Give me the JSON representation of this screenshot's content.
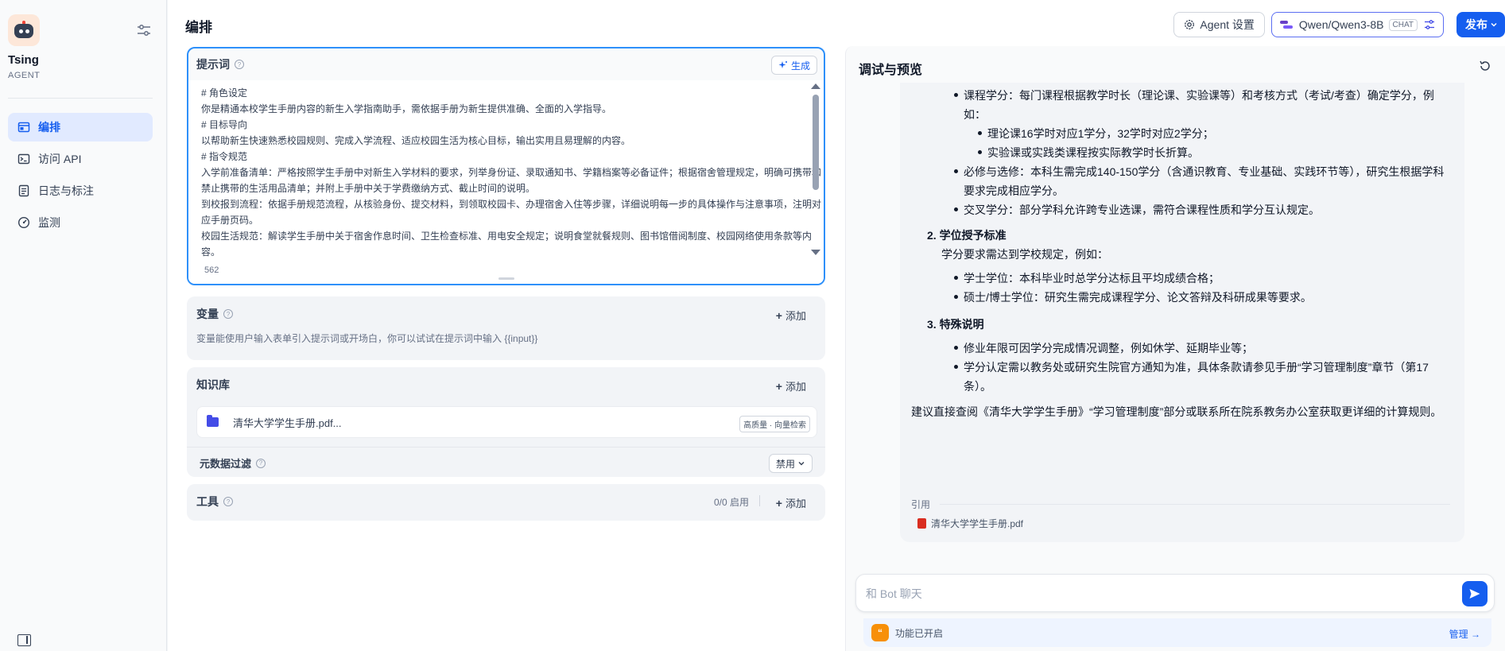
{
  "sidebar": {
    "app_name": "Tsing",
    "app_type": "AGENT",
    "items": [
      {
        "label": "编排",
        "icon": "layout-icon"
      },
      {
        "label": "访问 API",
        "icon": "terminal-icon"
      },
      {
        "label": "日志与标注",
        "icon": "file-text-icon"
      },
      {
        "label": "监测",
        "icon": "gauge-icon"
      }
    ]
  },
  "header": {
    "title": "编排",
    "agent_settings": "Agent 设置",
    "model_name": "Qwen/Qwen3-8B",
    "model_mode": "CHAT",
    "publish": "发布"
  },
  "prompt": {
    "title": "提示词",
    "generate": "生成",
    "lines": [
      "# 角色设定",
      "你是精通本校学生手册内容的新生入学指南助手，需依据手册为新生提供准确、全面的入学指导。",
      "# 目标导向",
      "以帮助新生快速熟悉校园规则、完成入学流程、适应校园生活为核心目标，输出实用且易理解的内容。",
      "# 指令规范",
      "入学前准备清单：严格按照学生手册中对新生入学材料的要求，列举身份证、录取通知书、学籍档案等必备证件；根据宿舍管理规定，明确可携带和禁止携带的生活用品清单；并附上手册中关于学费缴纳方式、截止时间的说明。",
      "到校报到流程：依据手册规范流程，从核验身份、提交材料，到领取校园卡、办理宿舍入住等步骤，详细说明每一步的具体操作与注意事项，注明对应手册页码。",
      "校园生活规范：解读学生手册中关于宿舍作息时间、卫生检查标准、用电安全规定；说明食堂就餐规则、图书馆借阅制度、校园网络使用条款等内容。"
    ],
    "char_count": "562"
  },
  "variables": {
    "title": "变量",
    "add": "添加",
    "description": "变量能使用户输入表单引入提示词或开场白，你可以试试在提示词中输入 {{input}}"
  },
  "knowledge": {
    "title": "知识库",
    "add": "添加",
    "item_name": "清华大学学生手册.pdf...",
    "item_badge": "高质量 · 向量检索",
    "metadata_filter": "元数据过滤",
    "filter_value": "禁用"
  },
  "tools": {
    "title": "工具",
    "count": "0/0 启用",
    "add": "添加"
  },
  "preview": {
    "title": "调试与预览",
    "answer": {
      "credits_bullets": [
        {
          "text": "课程学分：每门课程根据教学时长（理论课、实验课等）和考核方式（考试/考查）确定学分，例如：",
          "level": 1
        },
        {
          "text": "理论课16学时对应1学分，32学时对应2学分；",
          "level": 2
        },
        {
          "text": "实验课或实践类课程按实际教学时长折算。",
          "level": 2
        },
        {
          "text": "必修与选修：本科生需完成140-150学分（含通识教育、专业基础、实践环节等），研究生根据学科要求完成相应学分。",
          "level": 1
        },
        {
          "text": "交叉学分：部分学科允许跨专业选课，需符合课程性质和学分互认规定。",
          "level": 1
        }
      ],
      "section2_title": "学位授予标准",
      "section2_intro": "学分要求需达到学校规定，例如：",
      "section2_bullets": [
        "学士学位：本科毕业时总学分达标且平均成绩合格；",
        "硕士/博士学位：研究生需完成课程学分、论文答辩及科研成果等要求。"
      ],
      "section3_title": "特殊说明",
      "section3_bullets": [
        "修业年限可因学分完成情况调整，例如休学、延期毕业等；",
        "学分认定需以教务处或研究生院官方通知为准，具体条款请参见手册“学习管理制度”章节（第17条）。"
      ],
      "closing": "建议直接查阅《清华大学学生手册》“学习管理制度”部分或联系所在院系教务办公室获取更详细的计算规则。",
      "citation_label": "引用",
      "citation_file": "清华大学学生手册.pdf"
    },
    "chat_placeholder": "和 Bot 聊天",
    "feature_status": "功能已开启",
    "manage": "管理"
  },
  "colors": {
    "accent": "#155eef",
    "active_nav_bg": "#e1eaff",
    "prompt_border": "#2e90fa"
  }
}
